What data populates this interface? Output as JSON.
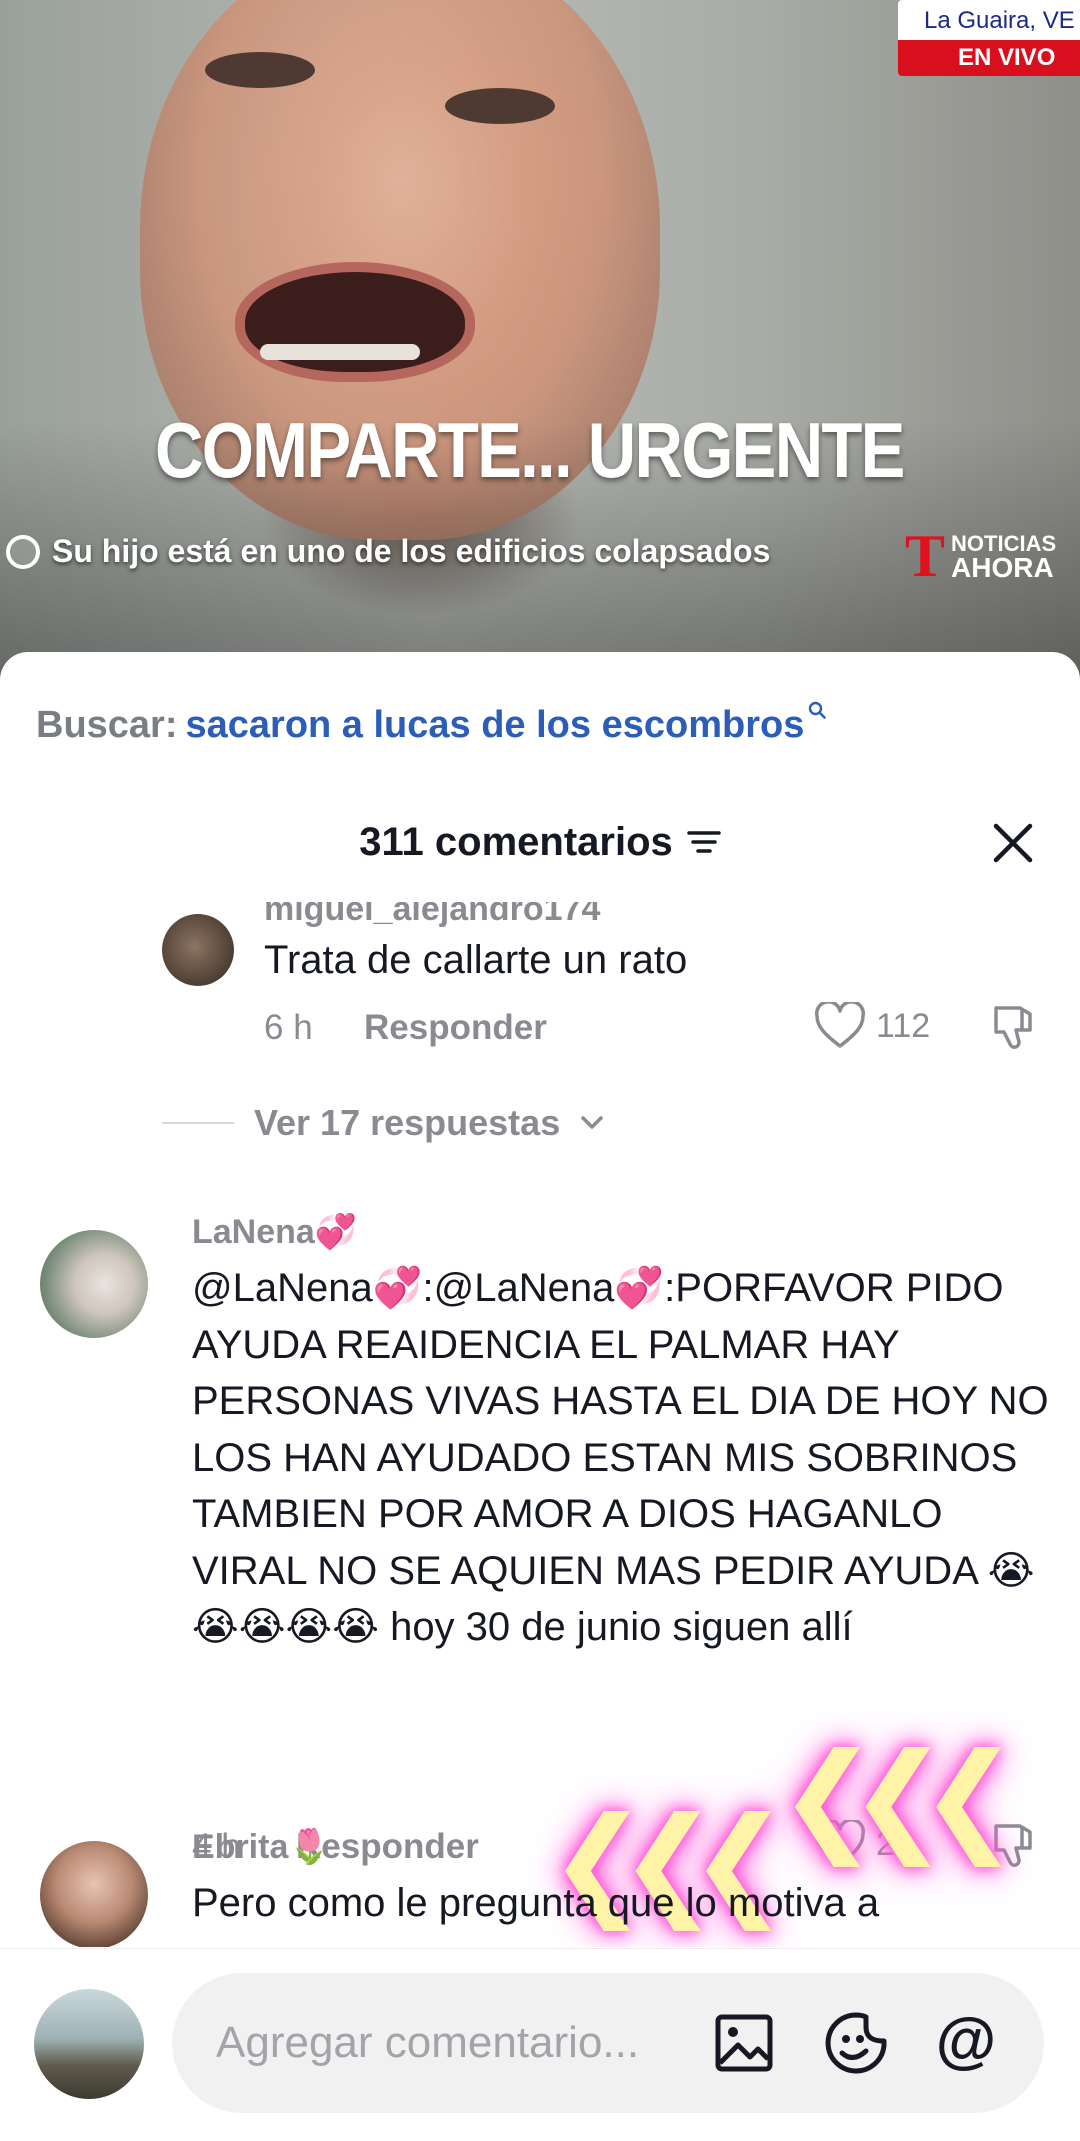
{
  "video": {
    "headline": "COMPARTE... URGENTE",
    "subtitle": "Su hijo está en uno de los edificios colapsados",
    "brand_top": "NOTICIAS",
    "brand_bottom": "AHORA",
    "location": "La Guaira, VE",
    "live": "EN VIVO"
  },
  "search": {
    "label": "Buscar:",
    "term": "sacaron a lucas de los escombros"
  },
  "header": {
    "comment_count": "311 comentarios"
  },
  "comments": [
    {
      "username": "miguel_alejandro174",
      "text": "Trata de callarte un rato",
      "time": "6 h",
      "reply_label": "Responder",
      "likes": "112"
    },
    {
      "username": "LaNena💞",
      "text": "@LaNena💞:@LaNena💞:PORFAVOR PIDO AYUDA REAIDENCIA EL PALMAR HAY PERSONAS VIVAS HASTA EL DIA DE HOY NO LOS HAN AYUDADO ESTAN MIS SOBRINOS TAMBIEN POR AMOR A DIOS HAGANLO VIRAL NO SE AQUIEN MAS PEDIR AYUDA 😭😭😭😭😭 hoy 30 de junio siguen allí",
      "time": "4 h",
      "reply_label": "Responder",
      "likes": "2"
    },
    {
      "username": "Ebrita🌷",
      "text": "Pero como le pregunta que lo motiva a"
    }
  ],
  "view_replies": "Ver 17 respuestas",
  "composer": {
    "placeholder": "Agregar comentario..."
  }
}
